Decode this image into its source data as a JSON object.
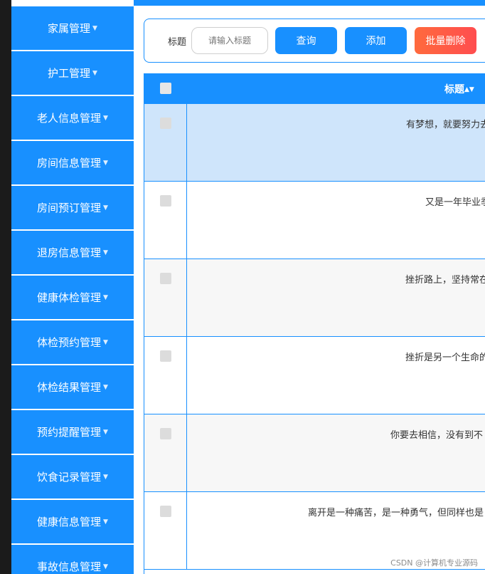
{
  "sidebar": {
    "items": [
      {
        "label": "家属管理"
      },
      {
        "label": "护工管理"
      },
      {
        "label": "老人信息管理"
      },
      {
        "label": "房间信息管理"
      },
      {
        "label": "房间预订管理"
      },
      {
        "label": "退房信息管理"
      },
      {
        "label": "健康体检管理"
      },
      {
        "label": "体检预约管理"
      },
      {
        "label": "体检结果管理"
      },
      {
        "label": "预约提醒管理"
      },
      {
        "label": "饮食记录管理"
      },
      {
        "label": "健康信息管理"
      },
      {
        "label": "事故信息管理"
      }
    ],
    "caret_icon": "caret-down-icon"
  },
  "search": {
    "label": "标题",
    "placeholder": "请输入标题",
    "query_button": "查询",
    "add_button": "添加",
    "batch_delete_button": "批量删除"
  },
  "table": {
    "header_title": "标题",
    "sort_icon": "sort-icon",
    "rows": [
      {
        "title": "有梦想，就要努力去"
      },
      {
        "title": "又是一年毕业季"
      },
      {
        "title": "挫折路上，坚持常在"
      },
      {
        "title": "挫折是另一个生命的"
      },
      {
        "title": "你要去相信，没有到不"
      },
      {
        "title": "离开是一种痛苦，是一种勇气，但同样也是"
      }
    ]
  },
  "watermark": "CSDN @计算机专业源码",
  "colors": {
    "primary": "#1890ff",
    "danger_start": "#ff6a3d",
    "danger_end": "#ff4d4f",
    "row_selected": "#cfe5fb",
    "row_alt": "#f7f7f7",
    "row_plain": "#ffffff"
  }
}
